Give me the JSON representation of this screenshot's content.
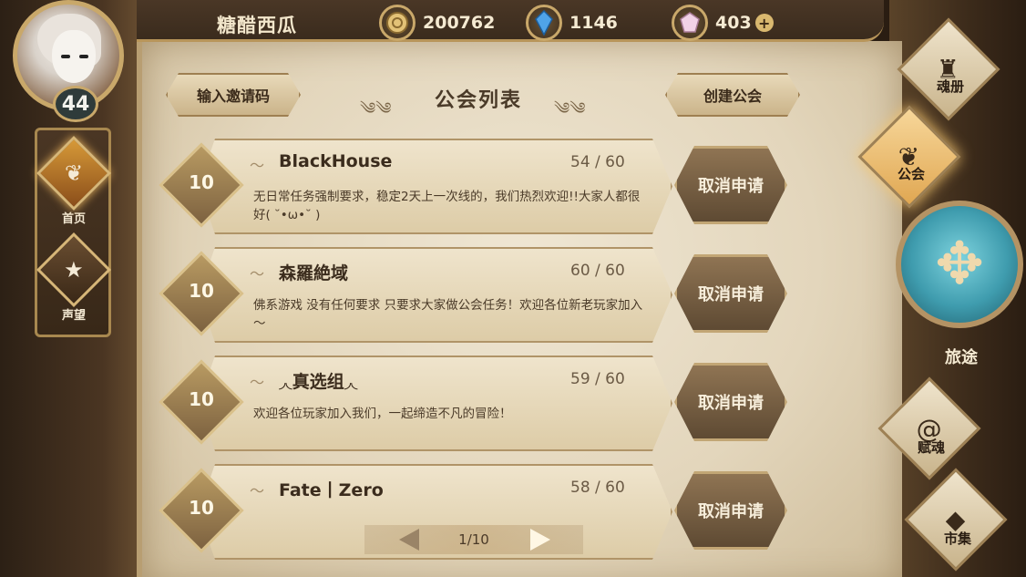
{
  "player": {
    "name": "糖醋西瓜",
    "level": "44"
  },
  "currencies": [
    {
      "icon": "gold-coin-icon",
      "value": "200762"
    },
    {
      "icon": "blue-crystal-icon",
      "value": "1146"
    },
    {
      "icon": "pink-gem-icon",
      "value": "403"
    }
  ],
  "plus_label": "+",
  "left_nav": [
    {
      "label": "首页",
      "icon": "feather-banner-icon",
      "active": true
    },
    {
      "label": "声望",
      "icon": "laurel-star-icon",
      "active": false
    }
  ],
  "header": {
    "invite_label": "输入邀请码",
    "title": "公会列表",
    "create_label": "创建公会"
  },
  "guilds": [
    {
      "level": "10",
      "name": "BlackHouse",
      "count": "54 / 60",
      "desc": "无日常任务强制要求，稳定2天上一次线的，我们热烈欢迎!!大家人都很好( ˘•ω•˘ )",
      "action": "取消申请"
    },
    {
      "level": "10",
      "name": "森羅絶域",
      "count": "60 / 60",
      "desc": "佛系游戏 没有任何要求 只要求大家做公会任务！欢迎各位新老玩家加入～",
      "action": "取消申请"
    },
    {
      "level": "10",
      "name": "◞◟真选组◞◟",
      "count": "59 / 60",
      "desc": "欢迎各位玩家加入我们，一起缔造不凡的冒险！",
      "action": "取消申请"
    },
    {
      "level": "10",
      "name": "Fate丨Zero",
      "count": "58 / 60",
      "desc": "",
      "action": "取消申请"
    }
  ],
  "pager": {
    "text": "1/10"
  },
  "right_nav": [
    {
      "label": "魂册",
      "icon": "soul-book-icon",
      "active": false
    },
    {
      "label": "公会",
      "icon": "guild-banner-icon",
      "active": true
    },
    {
      "label": "旅途",
      "icon": "journey-orb-icon",
      "active": false
    },
    {
      "label": "赋魂",
      "icon": "spiral-soul-icon",
      "active": false
    },
    {
      "label": "市集",
      "icon": "market-gem-icon",
      "active": false
    }
  ]
}
